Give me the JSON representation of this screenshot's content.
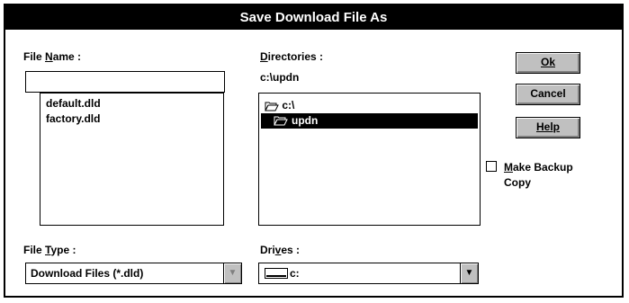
{
  "dialog": {
    "title": "Save Download File As",
    "file_name": {
      "label_pre": "File ",
      "label_accel": "N",
      "label_post": "ame :",
      "value": "",
      "files": [
        "default.dld",
        "factory.dld"
      ]
    },
    "directories": {
      "label_accel": "D",
      "label_post": "irectories :",
      "current_path": "c:\\updn",
      "tree": [
        {
          "name": "c:\\",
          "icon": "open-folder-icon",
          "selected": false
        },
        {
          "name": "updn",
          "icon": "open-folder-icon",
          "selected": true
        }
      ]
    },
    "buttons": {
      "ok": "Ok",
      "cancel": "Cancel",
      "help": "Help"
    },
    "make_backup": {
      "accel": "M",
      "label_line1_rest": "ake Backup",
      "label_line2": "Copy",
      "checked": false
    },
    "file_type": {
      "label_pre": "File ",
      "label_accel": "T",
      "label_post": "ype :",
      "value": "Download Files (*.dld)"
    },
    "drives": {
      "label_pre": "Dri",
      "label_accel": "v",
      "label_post": "es :",
      "value": "c:",
      "icon": "hard-drive-icon"
    }
  }
}
